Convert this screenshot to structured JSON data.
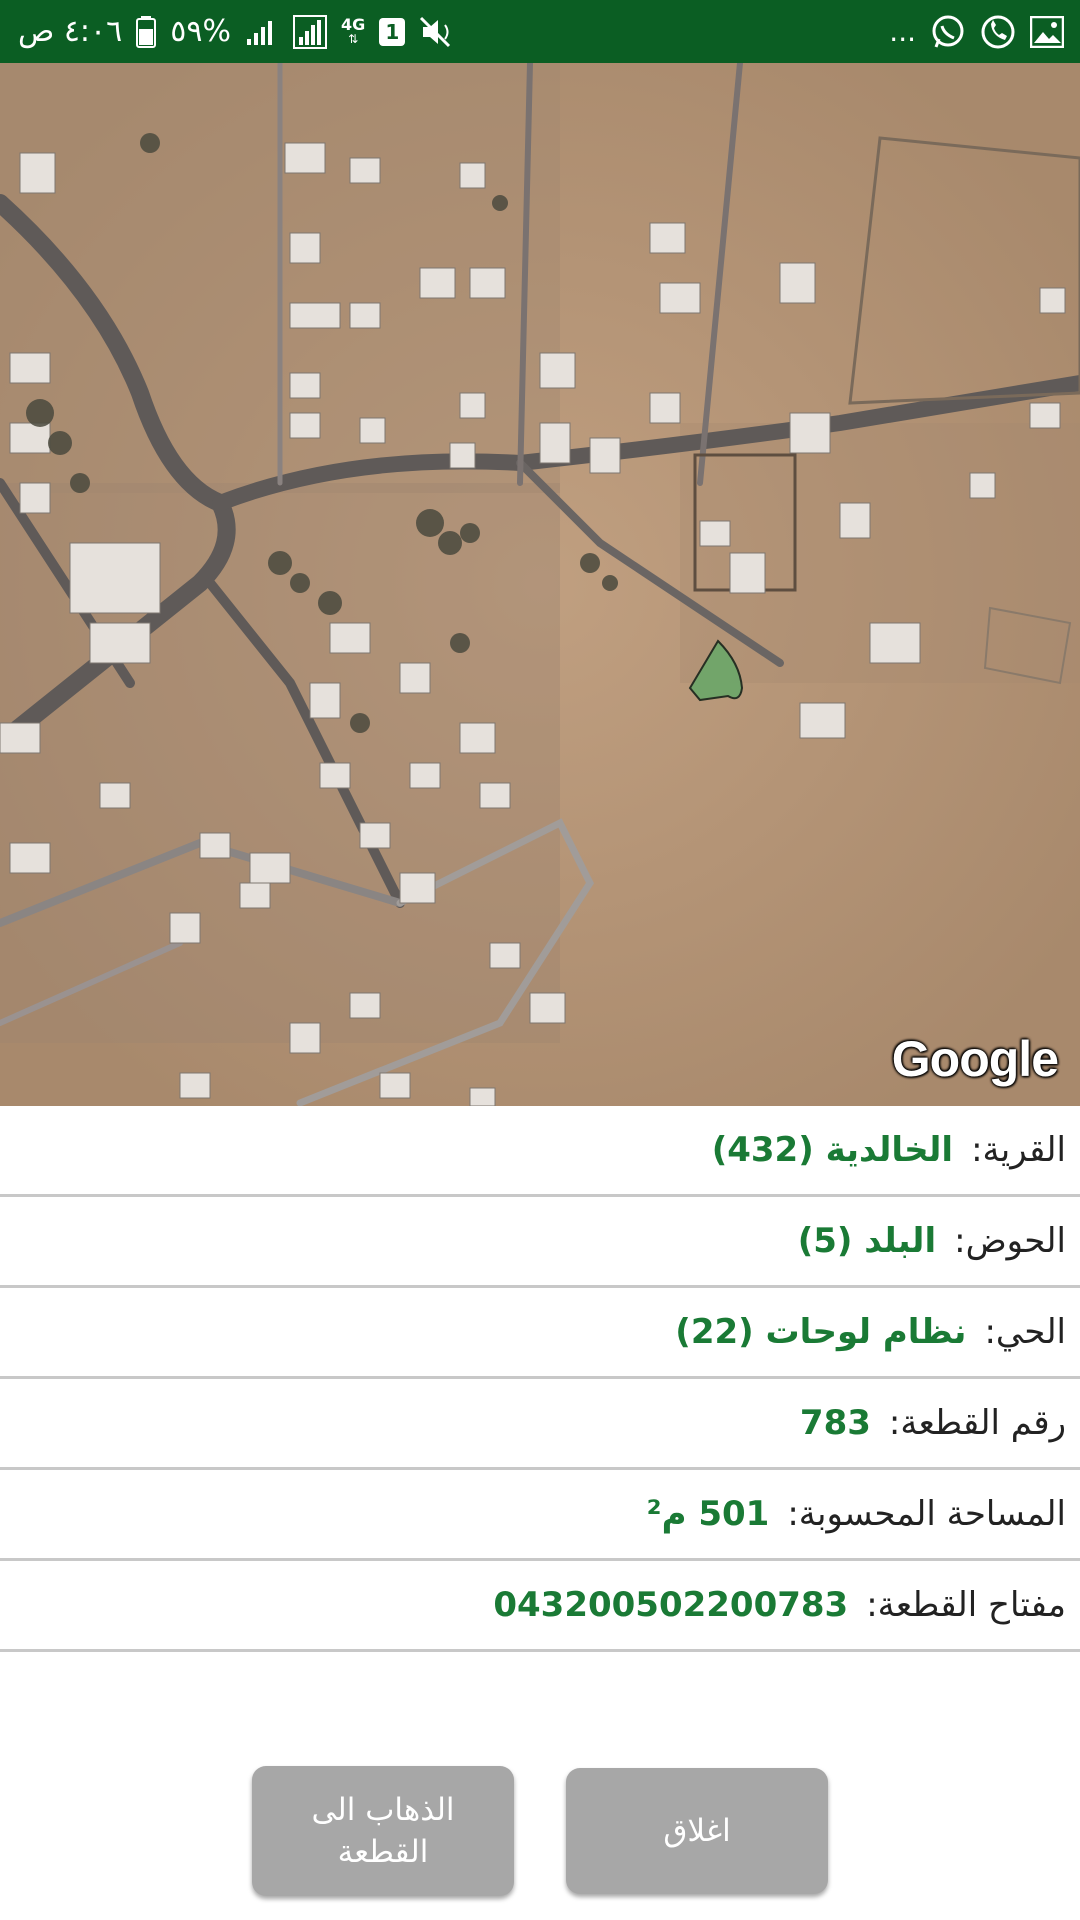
{
  "status_bar": {
    "time": "٤:٠٦ ص",
    "battery": "%٥٩",
    "network": "4G",
    "sim": "1",
    "more": "...",
    "icons": [
      "gallery-icon",
      "phone-icon",
      "whatsapp-icon",
      "mute-icon",
      "signal-icon",
      "battery-icon"
    ]
  },
  "map": {
    "provider_logo": "Google"
  },
  "parcel": {
    "village_label": "القرية:",
    "village_value": "الخالدية (432)",
    "basin_label": "الحوض:",
    "basin_value": "البلد (5)",
    "district_label": "الحي:",
    "district_value": "نظام لوحات (22)",
    "parcel_number_label": "رقم القطعة:",
    "parcel_number_value": "783",
    "area_label": "المساحة المحسوبة:",
    "area_value": "501 م²",
    "key_label": "مفتاح القطعة:",
    "key_value": "043200502200783"
  },
  "buttons": {
    "go_to_parcel": "الذهاب الى القطعة",
    "close": "اغلاق"
  },
  "colors": {
    "status_bar": "#0b5e23",
    "value_text": "#1a7a35",
    "button": "#a7a7a7",
    "parcel_fill": "#6fa66a"
  }
}
